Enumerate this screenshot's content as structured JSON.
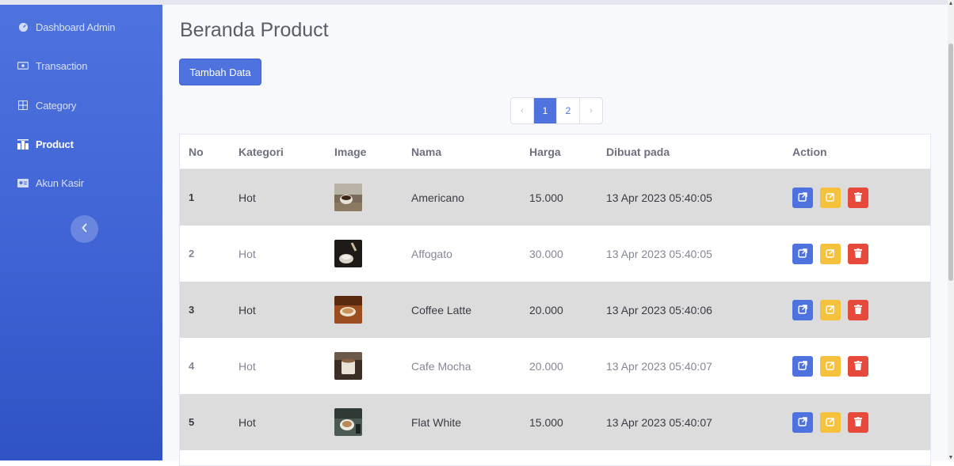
{
  "sidebar": {
    "items": [
      {
        "label": "Dashboard Admin",
        "icon": "dashboard-icon",
        "active": false
      },
      {
        "label": "Transaction",
        "icon": "money-icon",
        "active": false
      },
      {
        "label": "Category",
        "icon": "grid-icon",
        "active": false
      },
      {
        "label": "Product",
        "icon": "product-icon",
        "active": true
      },
      {
        "label": "Akun Kasir",
        "icon": "id-card-icon",
        "active": false
      }
    ],
    "toggle_icon": "chevron-left-icon"
  },
  "main": {
    "title": "Beranda Product",
    "add_button": "Tambah Data",
    "pagination": {
      "prev": "‹",
      "pages": [
        "1",
        "2"
      ],
      "next": "›",
      "current": "1"
    }
  },
  "table": {
    "headers": [
      "No",
      "Kategori",
      "Image",
      "Nama",
      "Harga",
      "Dibuat pada",
      "Action"
    ],
    "rows": [
      {
        "no": "1",
        "kategori": "Hot",
        "nama": "Americano",
        "harga": "15.000",
        "dibuat": "13 Apr 2023 05:40:05",
        "image": "americano"
      },
      {
        "no": "2",
        "kategori": "Hot",
        "nama": "Affogato",
        "harga": "30.000",
        "dibuat": "13 Apr 2023 05:40:05",
        "image": "affogato"
      },
      {
        "no": "3",
        "kategori": "Hot",
        "nama": "Coffee Latte",
        "harga": "20.000",
        "dibuat": "13 Apr 2023 05:40:06",
        "image": "latte"
      },
      {
        "no": "4",
        "kategori": "Hot",
        "nama": "Cafe Mocha",
        "harga": "20.000",
        "dibuat": "13 Apr 2023 05:40:07",
        "image": "mocha"
      },
      {
        "no": "5",
        "kategori": "Hot",
        "nama": "Flat White",
        "harga": "15.000",
        "dibuat": "13 Apr 2023 05:40:07",
        "image": "flatwhite"
      }
    ],
    "actions": [
      "external-link-icon",
      "edit-icon",
      "trash-icon"
    ]
  },
  "colors": {
    "primary": "#4e73df",
    "warning": "#f6c23e",
    "danger": "#e74a3b",
    "stripe": "#dcdcdc"
  }
}
